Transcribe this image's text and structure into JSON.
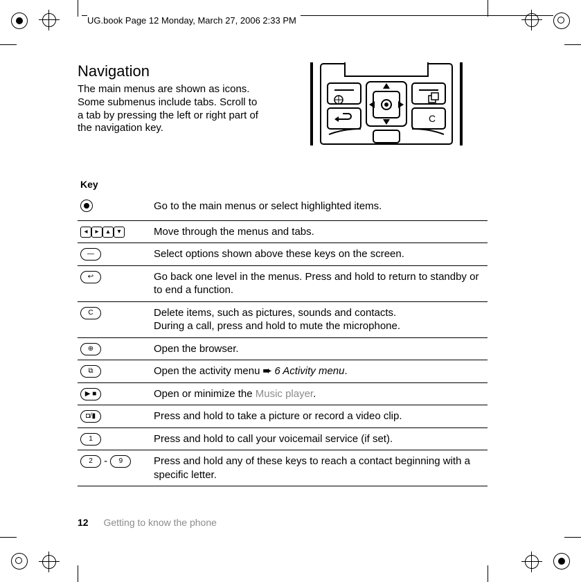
{
  "header": {
    "text": "UG.book  Page 12  Monday, March 27, 2006  2:33 PM"
  },
  "section": {
    "title": "Navigation",
    "intro": "The main menus are shown as icons. Some submenus include tabs. Scroll to a tab by pressing the left or right part of the navigation key."
  },
  "keytable": {
    "heading": "Key",
    "rows": [
      {
        "icon": "center-select",
        "glyph": "◉",
        "desc": "Go to the main menus or select highlighted items."
      },
      {
        "icon": "dpad-arrows",
        "glyph": "dpad4",
        "desc": "Move through the menus and tabs."
      },
      {
        "icon": "softkey",
        "glyph": "—",
        "desc": "Select options shown above these keys on the screen."
      },
      {
        "icon": "back-key",
        "glyph": "↩",
        "desc": "Go back one level in the menus. Press and hold to return to standby or to end a function."
      },
      {
        "icon": "c-key",
        "glyph": "C",
        "desc1": "Delete items, such as pictures, sounds and contacts.",
        "desc2": "During a call, press and hold to mute the microphone."
      },
      {
        "icon": "globe-key",
        "glyph": "⊕",
        "desc": "Open the browser."
      },
      {
        "icon": "activity-key",
        "glyph": "⧉",
        "desc_pre": "Open the activity menu ",
        "arrow": "➨",
        "link": " 6 Activity menu",
        "desc_post": "."
      },
      {
        "icon": "play-key",
        "glyph": "▶■",
        "desc_pre": "Open or minimize the ",
        "muted": "Music player",
        "desc_post": "."
      },
      {
        "icon": "camera-key",
        "glyph": "📷",
        "desc": "Press and hold to take a picture or record a video clip."
      },
      {
        "icon": "key-1",
        "glyph": "1",
        "desc": "Press and hold to call your voicemail service (if set)."
      },
      {
        "icon": "keys-2-9",
        "glyph_a": "2",
        "sep": " - ",
        "glyph_b": "9",
        "desc": "Press and hold any of these keys to reach a contact beginning with a specific letter."
      }
    ]
  },
  "footer": {
    "page": "12",
    "chapter": "Getting to know the phone"
  }
}
